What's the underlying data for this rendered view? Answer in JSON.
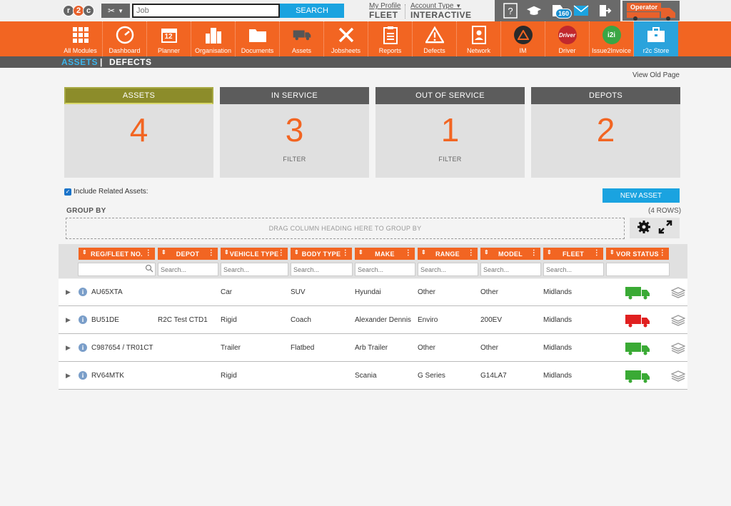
{
  "topbar": {
    "logo": [
      "r",
      "2",
      "c"
    ],
    "search_placeholder": "Job",
    "search_button": "SEARCH",
    "my_profile": "My Profile",
    "profile_value": "FLEET",
    "account_type": "Account Type",
    "account_value": "INTERACTIVE",
    "notification_count": "160",
    "operator_label": "Operator"
  },
  "nav": {
    "items": [
      {
        "label": "All Modules",
        "icon": "grid-icon"
      },
      {
        "label": "Dashboard",
        "icon": "gauge-icon"
      },
      {
        "label": "Planner",
        "icon": "calendar-icon"
      },
      {
        "label": "Organisation",
        "icon": "buildings-icon"
      },
      {
        "label": "Documents",
        "icon": "folder-icon"
      },
      {
        "label": "Assets",
        "icon": "truck-icon"
      },
      {
        "label": "Jobsheets",
        "icon": "tools-icon"
      },
      {
        "label": "Reports",
        "icon": "clipboard-icon"
      },
      {
        "label": "Defects",
        "icon": "warning-icon"
      },
      {
        "label": "Network",
        "icon": "contacts-icon"
      },
      {
        "label": "IM",
        "icon": "hazard-icon"
      },
      {
        "label": "Driver",
        "icon": "driver-icon"
      },
      {
        "label": "Issue2Invoice",
        "icon": "i2i-icon"
      },
      {
        "label": "r2c Store",
        "icon": "briefcase-icon"
      }
    ],
    "calendar_day": "12",
    "driver_badge": "Driver",
    "i2i_badge": "i2i"
  },
  "subnav": {
    "assets": "ASSETS",
    "separator": "|",
    "defects": "DEFECTS"
  },
  "view_old_page": "View Old Page",
  "cards": [
    {
      "title": "ASSETS",
      "value": "4",
      "filter": ""
    },
    {
      "title": "IN SERVICE",
      "value": "3",
      "filter": "FILTER"
    },
    {
      "title": "OUT OF SERVICE",
      "value": "1",
      "filter": "FILTER"
    },
    {
      "title": "DEPOTS",
      "value": "2",
      "filter": ""
    }
  ],
  "include_related": "Include Related Assets:",
  "new_asset_button": "NEW ASSET",
  "group_by_label": "GROUP BY",
  "rows_count": "(4 ROWS)",
  "drop_zone": "DRAG COLUMN HEADING HERE TO GROUP BY",
  "columns": [
    "REG/FLEET NO.",
    "DEPOT",
    "VEHICLE TYPE",
    "BODY TYPE",
    "MAKE",
    "RANGE",
    "MODEL",
    "FLEET",
    "VOR STATUS"
  ],
  "search_placeholder": "Search...",
  "colors": {
    "accent": "#f26522",
    "blue": "#1aa3e0",
    "vor_ok": "#3aaa35",
    "vor_off": "#e02020"
  },
  "rows": [
    {
      "reg": "AU65XTA",
      "depot": "",
      "vehicle_type": "Car",
      "body_type": "SUV",
      "make": "Hyundai",
      "range": "Other",
      "model": "Other",
      "fleet": "Midlands",
      "vor": "green"
    },
    {
      "reg": "BU51DE",
      "depot": "R2C Test CTD1",
      "vehicle_type": "Rigid",
      "body_type": "Coach",
      "make": "Alexander Dennis",
      "range": "Enviro",
      "model": "200EV",
      "fleet": "Midlands",
      "vor": "red"
    },
    {
      "reg": "C987654 / TR01CT",
      "depot": "",
      "vehicle_type": "Trailer",
      "body_type": "Flatbed",
      "make": "Arb Trailer",
      "range": "Other",
      "model": "Other",
      "fleet": "Midlands",
      "vor": "green"
    },
    {
      "reg": "RV64MTK",
      "depot": "",
      "vehicle_type": "Rigid",
      "body_type": "",
      "make": "Scania",
      "range": "G Series",
      "model": "G14LA7",
      "fleet": "Midlands",
      "vor": "green"
    }
  ]
}
